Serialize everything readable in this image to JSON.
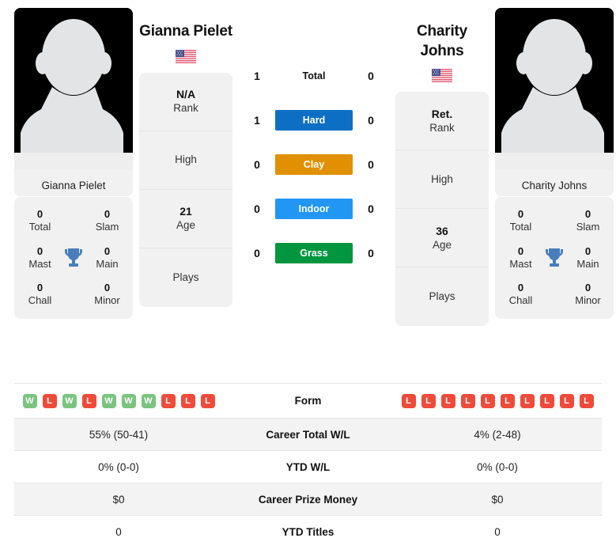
{
  "players": {
    "left": {
      "name": "Gianna Pielet",
      "photo_caption": "Gianna Pielet",
      "flag": "us-flag-icon",
      "rank_value": "N/A",
      "rank_label": "Rank",
      "high_label": "High",
      "high_value": "",
      "age_value": "21",
      "age_label": "Age",
      "plays_label": "Plays",
      "plays_value": "",
      "titles": {
        "total_num": "0",
        "total_lab": "Total",
        "slam_num": "0",
        "slam_lab": "Slam",
        "mast_num": "0",
        "mast_lab": "Mast",
        "main_num": "0",
        "main_lab": "Main",
        "chall_num": "0",
        "chall_lab": "Chall",
        "minor_num": "0",
        "minor_lab": "Minor"
      }
    },
    "right": {
      "name": "Charity Johns",
      "photo_caption": "Charity Johns",
      "flag": "us-flag-icon",
      "rank_value": "Ret.",
      "rank_label": "Rank",
      "high_label": "High",
      "high_value": "",
      "age_value": "36",
      "age_label": "Age",
      "plays_label": "Plays",
      "plays_value": "",
      "titles": {
        "total_num": "0",
        "total_lab": "Total",
        "slam_num": "0",
        "slam_lab": "Slam",
        "mast_num": "0",
        "mast_lab": "Mast",
        "main_num": "0",
        "main_lab": "Main",
        "chall_num": "0",
        "chall_lab": "Chall",
        "minor_num": "0",
        "minor_lab": "Minor"
      }
    }
  },
  "head_to_head": [
    {
      "label": "Total",
      "left": "1",
      "right": "0",
      "color": "none",
      "style": "plain"
    },
    {
      "label": "Hard",
      "left": "1",
      "right": "0",
      "color": "#0d6fc4",
      "style": "badge"
    },
    {
      "label": "Clay",
      "left": "0",
      "right": "0",
      "color": "#e09000",
      "style": "badge"
    },
    {
      "label": "Indoor",
      "left": "0",
      "right": "0",
      "color": "#2196f3",
      "style": "badge"
    },
    {
      "label": "Grass",
      "left": "0",
      "right": "0",
      "color": "#009640",
      "style": "badge"
    }
  ],
  "form": {
    "label": "Form",
    "left": [
      "W",
      "L",
      "W",
      "L",
      "W",
      "W",
      "W",
      "L",
      "L",
      "L"
    ],
    "right": [
      "L",
      "L",
      "L",
      "L",
      "L",
      "L",
      "L",
      "L",
      "L",
      "L"
    ],
    "win_color": "#7ac47f",
    "loss_color": "#ef4a3a"
  },
  "stats_rows": [
    {
      "label": "Career Total W/L",
      "left": "55% (50-41)",
      "right": "4% (2-48)"
    },
    {
      "label": "YTD W/L",
      "left": "0% (0-0)",
      "right": "0% (0-0)"
    },
    {
      "label": "Career Prize Money",
      "left": "$0",
      "right": "$0"
    },
    {
      "label": "YTD Titles",
      "left": "0",
      "right": "0"
    }
  ]
}
